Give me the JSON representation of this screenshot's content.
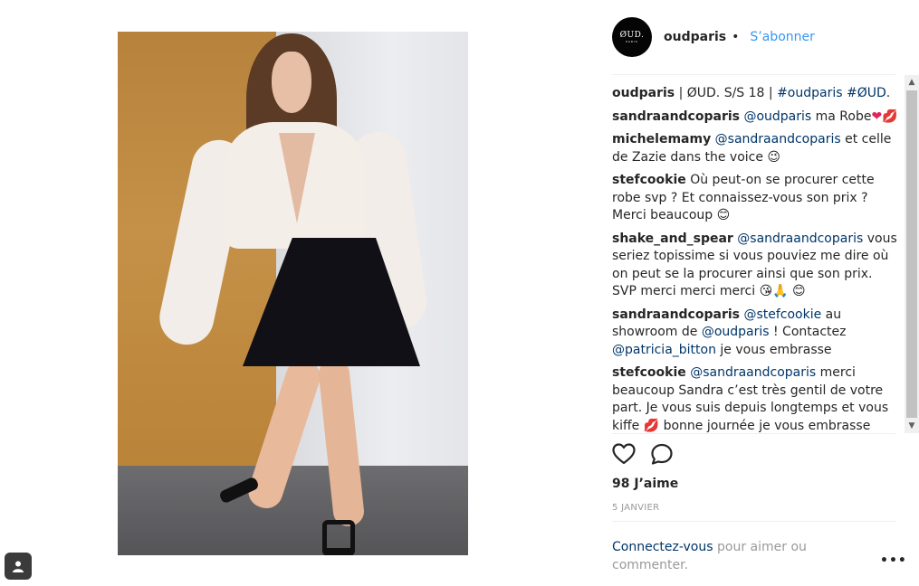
{
  "post": {
    "username": "oudparis",
    "dot": "•",
    "follow_label": "S’abonner",
    "avatar": {
      "brand": "ØUD.",
      "sub": "PARIS"
    },
    "likes": "98 J’aime",
    "date": "5 JANVIER",
    "login_link": "Connectez-vous",
    "login_rest": " pour aimer ou commenter.",
    "more": "•••"
  },
  "comments": [
    {
      "author": "oudparis",
      "segments": [
        {
          "t": " | ØUD. S/S 18 | "
        },
        {
          "t": "#oudparis",
          "m": true
        },
        {
          "t": " "
        },
        {
          "t": "#ØUD",
          "m": true
        },
        {
          "t": "."
        }
      ]
    },
    {
      "author": "sandraandcoparis",
      "segments": [
        {
          "t": " "
        },
        {
          "t": "@oudparis",
          "m": true
        },
        {
          "t": " ma Robe"
        },
        {
          "t": "❤💋",
          "h": true
        }
      ]
    },
    {
      "author": "michelemamy",
      "segments": [
        {
          "t": " "
        },
        {
          "t": "@sandraandcoparis",
          "m": true
        },
        {
          "t": " et celle de Zazie dans the voice 😉"
        }
      ]
    },
    {
      "author": "stefcookie",
      "segments": [
        {
          "t": " Où peut-on se procurer cette robe svp ? Et connaissez-vous son prix ? Merci beaucoup 😊"
        }
      ]
    },
    {
      "author": "shake_and_spear",
      "segments": [
        {
          "t": " "
        },
        {
          "t": "@sandraandcoparis",
          "m": true
        },
        {
          "t": " vous seriez topissime si vous pouviez me dire où on peut se la procurer ainsi que son prix. SVP merci merci merci 😘🙏 😊"
        }
      ]
    },
    {
      "author": "sandraandcoparis",
      "segments": [
        {
          "t": " "
        },
        {
          "t": "@stefcookie",
          "m": true
        },
        {
          "t": " au showroom de "
        },
        {
          "t": "@oudparis",
          "m": true
        },
        {
          "t": " ! Contactez "
        },
        {
          "t": "@patricia_bitton",
          "m": true
        },
        {
          "t": " je vous embrasse"
        }
      ]
    },
    {
      "author": "stefcookie",
      "segments": [
        {
          "t": " "
        },
        {
          "t": "@sandraandcoparis",
          "m": true
        },
        {
          "t": " merci beaucoup Sandra c’est très gentil de votre part. Je vous suis depuis longtemps et vous kiffe 💋 bonne journée je vous embrasse"
        }
      ]
    }
  ],
  "icons": {
    "like": "heart-outline-icon",
    "comment": "speech-bubble-icon",
    "corner": "person-badge-icon"
  }
}
